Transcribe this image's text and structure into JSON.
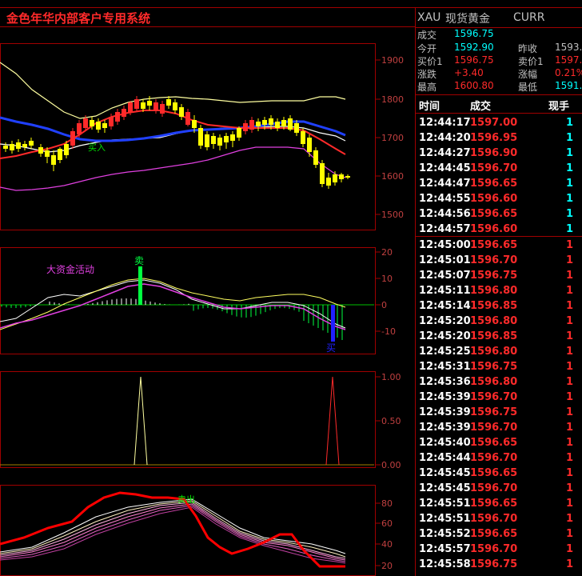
{
  "app": {
    "title": "金色年华内部客户专用系统",
    "title_color": "#ff2a2a"
  },
  "chart": {
    "price_axis": [
      "1900",
      "1800",
      "1700",
      "1600",
      "1500"
    ],
    "indicator": {
      "label": "大资金活动",
      "axis": [
        "20",
        "10",
        "0",
        "-10"
      ],
      "sell_mark": "卖",
      "buy_mark": "买"
    },
    "signal": {
      "axis": [
        "1.00",
        "0.50",
        "0.00"
      ]
    },
    "oscillator": {
      "axis": [
        "80",
        "60",
        "40",
        "20"
      ],
      "mark": "卖出"
    },
    "main_buy_mark": "买入"
  },
  "quote": {
    "symbol": "XAU",
    "name": "现货黄金",
    "mode": "CURR",
    "last_label": "成交",
    "last": "1596.75",
    "open_label": "今开",
    "open": "1592.90",
    "prev_label": "昨收",
    "prev": "1593.",
    "bid_label": "买价1",
    "bid": "1596.75",
    "ask_label": "卖价1",
    "ask": "1597.",
    "chg_label": "涨跌",
    "chg": "+3.40",
    "pct_label": "涨幅",
    "pct": "0.21%",
    "high_label": "最高",
    "high": "1600.80",
    "low_label": "最低",
    "low": "1591."
  },
  "ticks": {
    "headers": {
      "time": "时间",
      "price": "成交",
      "qty": "现手"
    },
    "rows": [
      {
        "time": "12:44:17",
        "price": "1597.00",
        "qty": "1",
        "dir": "up"
      },
      {
        "time": "12:44:20",
        "price": "1596.95",
        "qty": "1",
        "dir": "up"
      },
      {
        "time": "12:44:27",
        "price": "1596.90",
        "qty": "1",
        "dir": "up"
      },
      {
        "time": "12:44:45",
        "price": "1596.70",
        "qty": "1",
        "dir": "up"
      },
      {
        "time": "12:44:47",
        "price": "1596.65",
        "qty": "1",
        "dir": "up"
      },
      {
        "time": "12:44:55",
        "price": "1596.60",
        "qty": "1",
        "dir": "up"
      },
      {
        "time": "12:44:56",
        "price": "1596.65",
        "qty": "1",
        "dir": "up"
      },
      {
        "time": "12:44:57",
        "price": "1596.60",
        "qty": "1",
        "dir": "up"
      },
      {
        "time": "12:45:00",
        "price": "1596.65",
        "qty": "1",
        "dir": "dn"
      },
      {
        "time": "12:45:01",
        "price": "1596.70",
        "qty": "1",
        "dir": "dn"
      },
      {
        "time": "12:45:07",
        "price": "1596.75",
        "qty": "1",
        "dir": "dn"
      },
      {
        "time": "12:45:11",
        "price": "1596.80",
        "qty": "1",
        "dir": "dn"
      },
      {
        "time": "12:45:14",
        "price": "1596.85",
        "qty": "1",
        "dir": "dn"
      },
      {
        "time": "12:45:20",
        "price": "1596.80",
        "qty": "1",
        "dir": "dn"
      },
      {
        "time": "12:45:20",
        "price": "1596.85",
        "qty": "1",
        "dir": "dn"
      },
      {
        "time": "12:45:25",
        "price": "1596.80",
        "qty": "1",
        "dir": "dn"
      },
      {
        "time": "12:45:31",
        "price": "1596.75",
        "qty": "1",
        "dir": "dn"
      },
      {
        "time": "12:45:36",
        "price": "1596.80",
        "qty": "1",
        "dir": "dn"
      },
      {
        "time": "12:45:39",
        "price": "1596.70",
        "qty": "1",
        "dir": "dn"
      },
      {
        "time": "12:45:39",
        "price": "1596.75",
        "qty": "1",
        "dir": "dn"
      },
      {
        "time": "12:45:39",
        "price": "1596.70",
        "qty": "1",
        "dir": "dn"
      },
      {
        "time": "12:45:40",
        "price": "1596.65",
        "qty": "1",
        "dir": "dn"
      },
      {
        "time": "12:45:44",
        "price": "1596.70",
        "qty": "1",
        "dir": "dn"
      },
      {
        "time": "12:45:45",
        "price": "1596.65",
        "qty": "1",
        "dir": "dn"
      },
      {
        "time": "12:45:45",
        "price": "1596.70",
        "qty": "1",
        "dir": "dn"
      },
      {
        "time": "12:45:51",
        "price": "1596.65",
        "qty": "1",
        "dir": "dn"
      },
      {
        "time": "12:45:51",
        "price": "1596.70",
        "qty": "1",
        "dir": "dn"
      },
      {
        "time": "12:45:52",
        "price": "1596.65",
        "qty": "1",
        "dir": "dn"
      },
      {
        "time": "12:45:57",
        "price": "1596.70",
        "qty": "1",
        "dir": "dn"
      },
      {
        "time": "12:45:58",
        "price": "1596.75",
        "qty": "1",
        "dir": "dn"
      }
    ]
  },
  "colors": {
    "up": "#ff2a2a",
    "down": "#ffff00",
    "cyan": "#00ffff",
    "grid": "#a00000",
    "label": "#c0c0c0",
    "time": "#ffffff"
  }
}
